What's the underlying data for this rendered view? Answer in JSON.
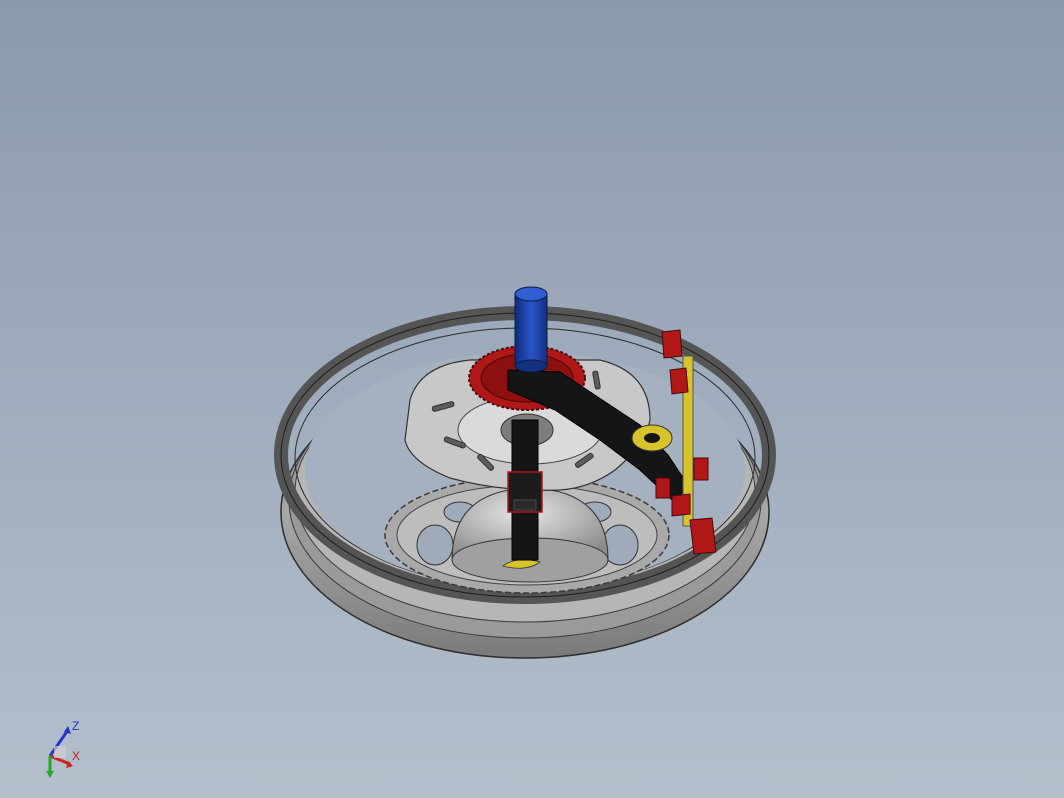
{
  "viewport": {
    "background_top": "#8a99ac",
    "background_bottom": "#b4bfcc"
  },
  "model": {
    "part_colors": {
      "rim": "#8c8c8c",
      "rotor": "#c9c9c9",
      "rear_sprocket": "#b0b0b0",
      "drive_sprocket": "#b01818",
      "shaft": "#1d3fa0",
      "arm": "#151515",
      "yellow_parts": "#d8c32a"
    }
  },
  "triad": {
    "z_label": "Z",
    "x_label": "X",
    "z_color": "#2233cc",
    "x_color": "#cc2222",
    "y_color": "#22aa22"
  }
}
